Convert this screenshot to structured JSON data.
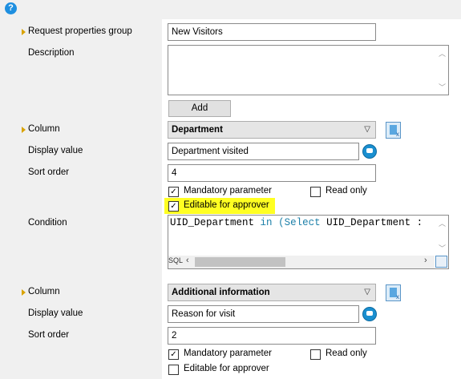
{
  "help_icon": "?",
  "request_group": {
    "label": "Request properties group",
    "value": "New Visitors"
  },
  "description": {
    "label": "Description",
    "value": ""
  },
  "add_button": "Add",
  "block1": {
    "column_label": "Column",
    "column_value": "Department",
    "display_label": "Display value",
    "display_value": "Department visited",
    "sort_label": "Sort order",
    "sort_value": "4",
    "mandatory_label": "Mandatory parameter",
    "mandatory_checked": true,
    "readonly_label": "Read only",
    "readonly_checked": false,
    "editable_label": "Editable for approver",
    "editable_checked": true,
    "condition_label": "Condition",
    "condition_code": {
      "field": "UID_Department",
      "op": "in",
      "paren": "(",
      "select": "Select",
      "rest": "UID_Department :"
    },
    "sql_label": "SQL"
  },
  "block2": {
    "column_label": "Column",
    "column_value": "Additional information",
    "display_label": "Display value",
    "display_value": "Reason for visit",
    "sort_label": "Sort order",
    "sort_value": "2",
    "mandatory_label": "Mandatory parameter",
    "mandatory_checked": true,
    "readonly_label": "Read only",
    "readonly_checked": false,
    "editable_label": "Editable for approver",
    "editable_checked": false
  },
  "colors": {
    "highlight": "#ffff22",
    "marker": "#d9a300",
    "keyword": "#1b7fa8",
    "panel": "#f0f0f0"
  }
}
